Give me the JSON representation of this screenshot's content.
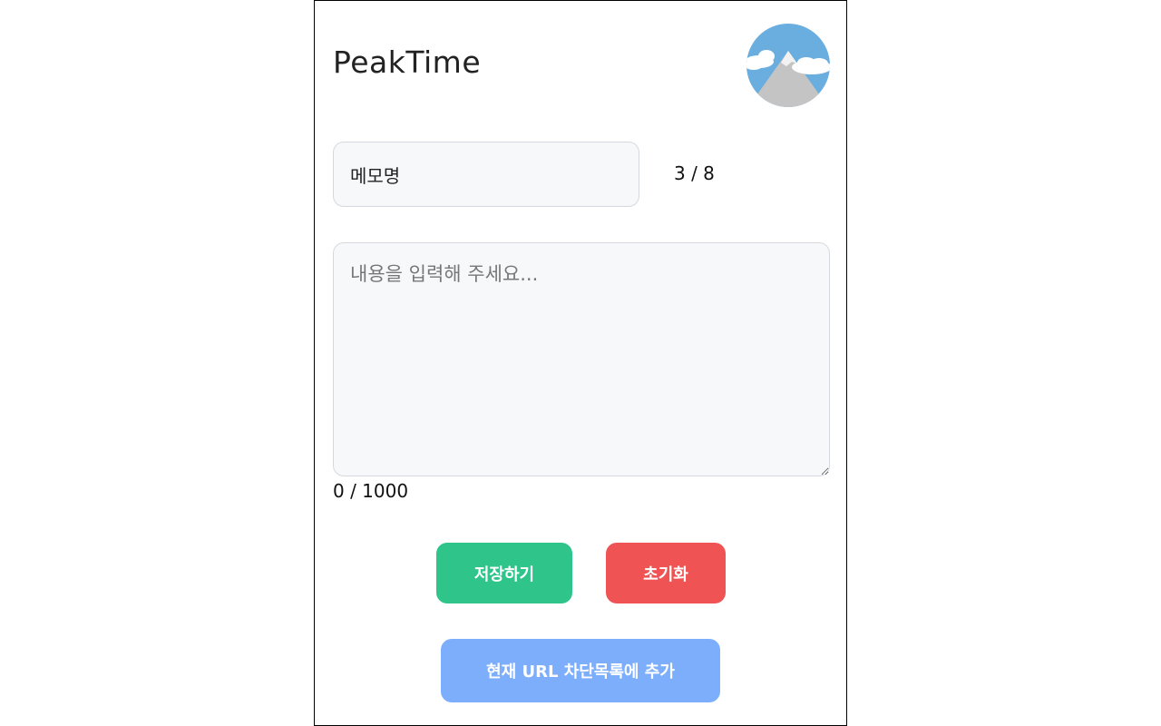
{
  "app": {
    "title": "PeakTime",
    "logo_icon": "mountain-logo-icon"
  },
  "memo_name": {
    "value": "메모명",
    "count": "3 / 8"
  },
  "memo_body": {
    "value": "",
    "placeholder": "내용을 입력해 주세요...",
    "count": "0 / 1000"
  },
  "buttons": {
    "save": "저장하기",
    "reset": "초기화",
    "block_url": "현재 URL 차단목록에 추가"
  },
  "colors": {
    "save": "#2fc48a",
    "reset": "#ef5353",
    "block_url": "#7daefc",
    "sky": "#6aaee0",
    "mountain": "#c4c4c4"
  }
}
